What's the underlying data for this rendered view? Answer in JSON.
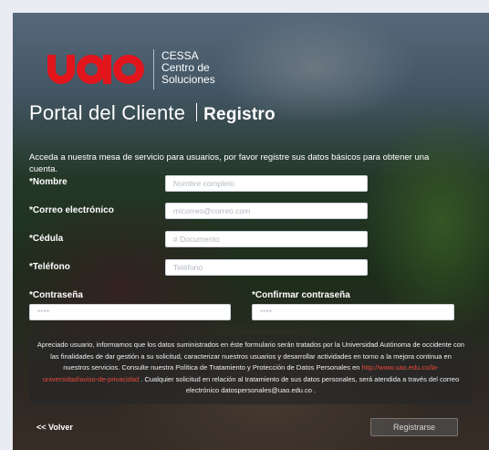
{
  "brand": {
    "logo_word": "uao",
    "logo_line1": "CESSA",
    "logo_line2": "Centro de",
    "logo_line3": "Soluciones",
    "accent": "#e1151b"
  },
  "header": {
    "portal_title": "Portal del Cliente",
    "section_title": "Registro"
  },
  "intro_text": "Acceda a nuestra mesa de servicio para usuarios, por favor registre sus datos básicos para obtener una cuenta.",
  "form": {
    "nombre_label": "*Nombre",
    "nombre_placeholder": "Nombre completo",
    "nombre_value": "",
    "correo_label": "*Correo electrónico",
    "correo_placeholder": "micorreo@correo.com",
    "correo_value": "",
    "cedula_label": "*Cédula",
    "cedula_placeholder": "# Documento",
    "cedula_value": "",
    "telefono_label": "*Teléfono",
    "telefono_placeholder": "Teléfono",
    "telefono_value": "",
    "password_label": "*Contraseña",
    "password_placeholder": "****",
    "confirm_label": "*Confirmar contraseña",
    "confirm_placeholder": "****"
  },
  "notice": {
    "text_1": "Apreciado usuario, informamos que los datos suministrados en éste formulario serán tratados por la Universidad Autónoma de occidente con las finalidades de dar gestión a su solicitud, caracterizar nuestros usuarios y desarrollar actividades en torno a la mejora continua en nuestros servicios. Consulte nuestra Política de Tratamiento y Protección de Datos Personales en ",
    "link": "http://www.uao.edu.co/la-universidad/aviso-de-privacidad",
    "text_2": " . Cualquier solicitud en relación al tratamiento de sus datos personales, será atendida a través del correo electrónico datospersonales@uao.edu.co ."
  },
  "actions": {
    "back_label": "<< Volver",
    "submit_label": "Registrarse"
  }
}
